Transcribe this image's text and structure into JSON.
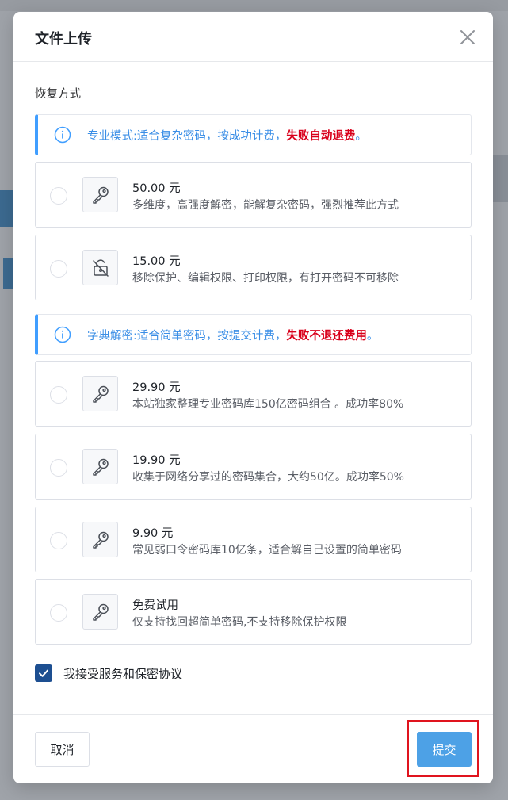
{
  "dialog": {
    "title": "文件上传",
    "section_label": "恢复方式"
  },
  "notices": [
    {
      "text": "专业模式:适合复杂密码，按成功计费，",
      "warn": "失败自动退费",
      "end": "。",
      "icon": "info-icon"
    },
    {
      "text": "字典解密:适合简单密码，按提交计费，",
      "warn": "失败不退还费用",
      "end": "。",
      "icon": "info-icon"
    }
  ],
  "options": [
    {
      "title": "50.00 元",
      "desc": "多维度，高强度解密，能解复杂密码，强烈推荐此方式",
      "icon": "key-icon",
      "selected": false
    },
    {
      "title": "15.00 元",
      "desc": "移除保护、编辑权限、打印权限，有打开密码不可移除",
      "icon": "unlock-icon",
      "selected": false
    },
    {
      "title": "29.90 元",
      "desc": "本站独家整理专业密码库150亿密码组合 。成功率80%",
      "icon": "key-icon",
      "selected": false
    },
    {
      "title": "19.90 元",
      "desc": "收集于网络分享过的密码集合，大约50亿。成功率50%",
      "icon": "key-icon",
      "selected": false
    },
    {
      "title": "9.90 元",
      "desc": "常见弱口令密码库10亿条，适合解自己设置的简单密码",
      "icon": "key-icon",
      "selected": false
    },
    {
      "title": "免费试用",
      "desc": "仅支持找回超简单密码,不支持移除保护权限",
      "icon": "key-icon",
      "selected": false
    }
  ],
  "agreement": {
    "label": "我接受服务和保密协议",
    "checked": true
  },
  "footer": {
    "cancel_label": "取消",
    "submit_label": "提交"
  },
  "colors": {
    "accent": "#409eff",
    "warn": "#d9001b",
    "submit": "#4da1e6",
    "highlight": "#e0141e",
    "checkbox": "#1d4f91"
  }
}
